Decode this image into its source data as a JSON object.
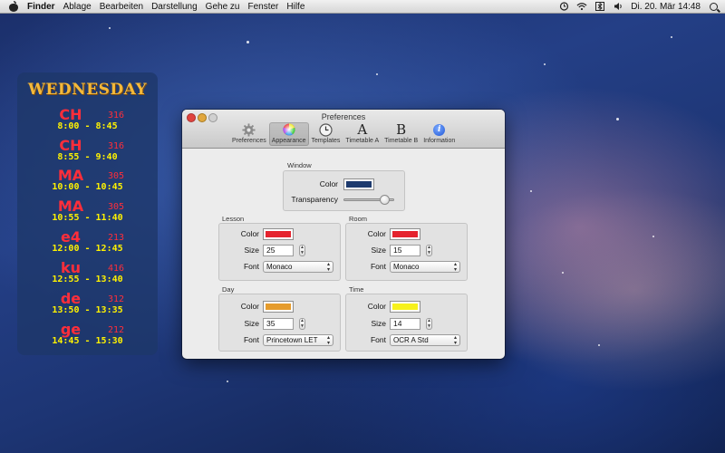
{
  "menubar": {
    "app": "Finder",
    "items": [
      "Ablage",
      "Bearbeiten",
      "Darstellung",
      "Gehe zu",
      "Fenster",
      "Hilfe"
    ],
    "clock": "Di. 20. Mär  14:48"
  },
  "widget": {
    "day": "WEDNESDAY",
    "lessons": [
      {
        "name": "CH",
        "room": "316",
        "time": "8:00 - 8:45"
      },
      {
        "name": "CH",
        "room": "316",
        "time": "8:55 - 9:40"
      },
      {
        "name": "MA",
        "room": "305",
        "time": "10:00 - 10:45"
      },
      {
        "name": "MA",
        "room": "305",
        "time": "10:55 - 11:40"
      },
      {
        "name": "e4",
        "room": "213",
        "time": "12:00 - 12:45"
      },
      {
        "name": "ku",
        "room": "416",
        "time": "12:55 - 13:40"
      },
      {
        "name": "de",
        "room": "312",
        "time": "13:50 - 13:35"
      },
      {
        "name": "ge",
        "room": "212",
        "time": "14:45 - 15:30"
      }
    ],
    "colors": {
      "day": "#f4b93a",
      "name": "#ff2e3a",
      "time": "#fff200"
    }
  },
  "window": {
    "title": "Preferences",
    "toolbar": [
      {
        "label": "Preferences",
        "icon": "gear-icon"
      },
      {
        "label": "Appearance",
        "icon": "color-wheel-icon",
        "active": true
      },
      {
        "label": "Templates",
        "icon": "clock-icon"
      },
      {
        "label": "Timetable A",
        "icon": "letter-a-icon",
        "glyph": "A"
      },
      {
        "label": "Timetable B",
        "icon": "letter-b-icon",
        "glyph": "B"
      },
      {
        "label": "Information",
        "icon": "info-icon",
        "glyph": "i"
      }
    ],
    "window_group": {
      "label": "Window",
      "color_label": "Color",
      "color": "#1d3a6e",
      "transparency_label": "Transparency",
      "transparency_value": 0.78
    },
    "lesson_group": {
      "label": "Lesson",
      "color_label": "Color",
      "color": "#e5232e",
      "size_label": "Size",
      "size": "25",
      "font_label": "Font",
      "font": "Monaco"
    },
    "room_group": {
      "label": "Room",
      "color_label": "Color",
      "color": "#e5232e",
      "size_label": "Size",
      "size": "15",
      "font_label": "Font",
      "font": "Monaco"
    },
    "day_group": {
      "label": "Day",
      "color_label": "Color",
      "color": "#e59b2c",
      "size_label": "Size",
      "size": "35",
      "font_label": "Font",
      "font": "Princetown LET"
    },
    "time_group": {
      "label": "Time",
      "color_label": "Color",
      "color": "#f7f11c",
      "size_label": "Size",
      "size": "14",
      "font_label": "Font",
      "font": "OCR A Std"
    }
  }
}
